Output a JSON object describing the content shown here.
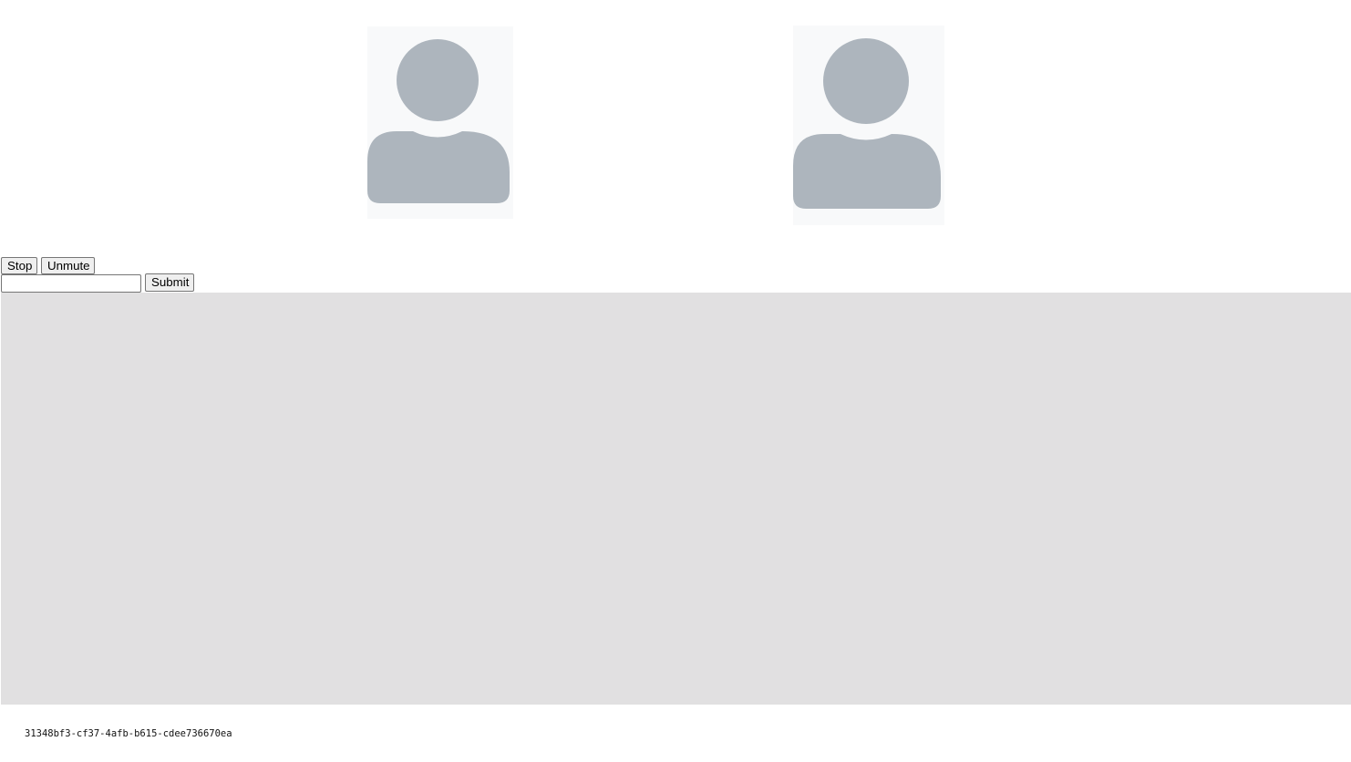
{
  "avatars": [
    {
      "icon": "user-avatar-icon",
      "bg_color": "#f8f9fa",
      "fill_color": "#adb5bd"
    },
    {
      "icon": "user-avatar-icon",
      "bg_color": "#f8f9fa",
      "fill_color": "#adb5bd"
    }
  ],
  "controls": {
    "stop_label": "Stop",
    "unmute_label": "Unmute"
  },
  "form": {
    "input_value": "",
    "input_placeholder": "",
    "submit_label": "Submit"
  },
  "stage": {
    "bg_color": "#e1e0e1"
  },
  "footer": {
    "session_id": "31348bf3-cf37-4afb-b615-cdee736670ea"
  }
}
